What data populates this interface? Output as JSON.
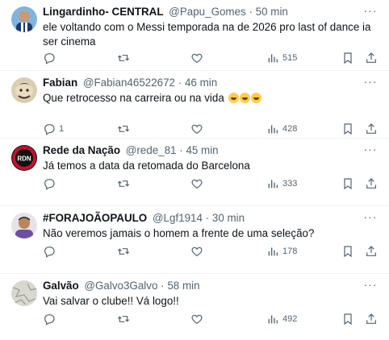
{
  "tweets": [
    {
      "name": "Lingardinho- CENTRAL",
      "handle": "@Papu_Gomes",
      "dot": "·",
      "time": "50 min",
      "text": "ele voltando com o Messi temporada na de 2026 pro last of dance ia ser cinema",
      "replies": "",
      "retweets": "",
      "likes": "",
      "views": "515",
      "avatar_colors": [
        "#5aa0d8",
        "#1b3c6b"
      ]
    },
    {
      "name": "Fabian",
      "handle": "@Fabian46522672",
      "dot": "·",
      "time": "46 min",
      "text": "Que retrocesso  na carreira ou na vida",
      "emoji_count": 3,
      "replies": "1",
      "retweets": "",
      "likes": "",
      "views": "428",
      "avatar_colors": [
        "#c8b89a",
        "#4a3a2a"
      ]
    },
    {
      "name": "Rede da Nação",
      "handle": "@rede_81",
      "dot": "·",
      "time": "45 min",
      "text": "Já temos a data da retomada do Barcelona",
      "replies": "",
      "retweets": "",
      "likes": "",
      "views": "333",
      "avatar_text": "RDN",
      "avatar_colors": [
        "#c8102e",
        "#111111"
      ]
    },
    {
      "name": "#FORAJOÃOPAULO",
      "handle": "@Lgf1914",
      "dot": "·",
      "time": "30 min",
      "text": "Não veremos jamais o homem a frente de uma seleção?",
      "replies": "",
      "retweets": "",
      "likes": "",
      "views": "178",
      "avatar_colors": [
        "#6b4fa0",
        "#d9a679"
      ]
    },
    {
      "name": "Galvão",
      "handle": "@Galvo3Galvo",
      "dot": "·",
      "time": "58 min",
      "text": "Vai salvar o clube!! Vá logo!!",
      "replies": "",
      "retweets": "",
      "likes": "",
      "views": "492",
      "avatar_colors": [
        "#d8d8d0",
        "#9a9a90"
      ]
    }
  ],
  "icons": {
    "more": "more-icon",
    "reply": "reply-icon",
    "retweet": "retweet-icon",
    "like": "heart-icon",
    "views": "views-icon",
    "bookmark": "bookmark-icon",
    "share": "share-icon"
  }
}
